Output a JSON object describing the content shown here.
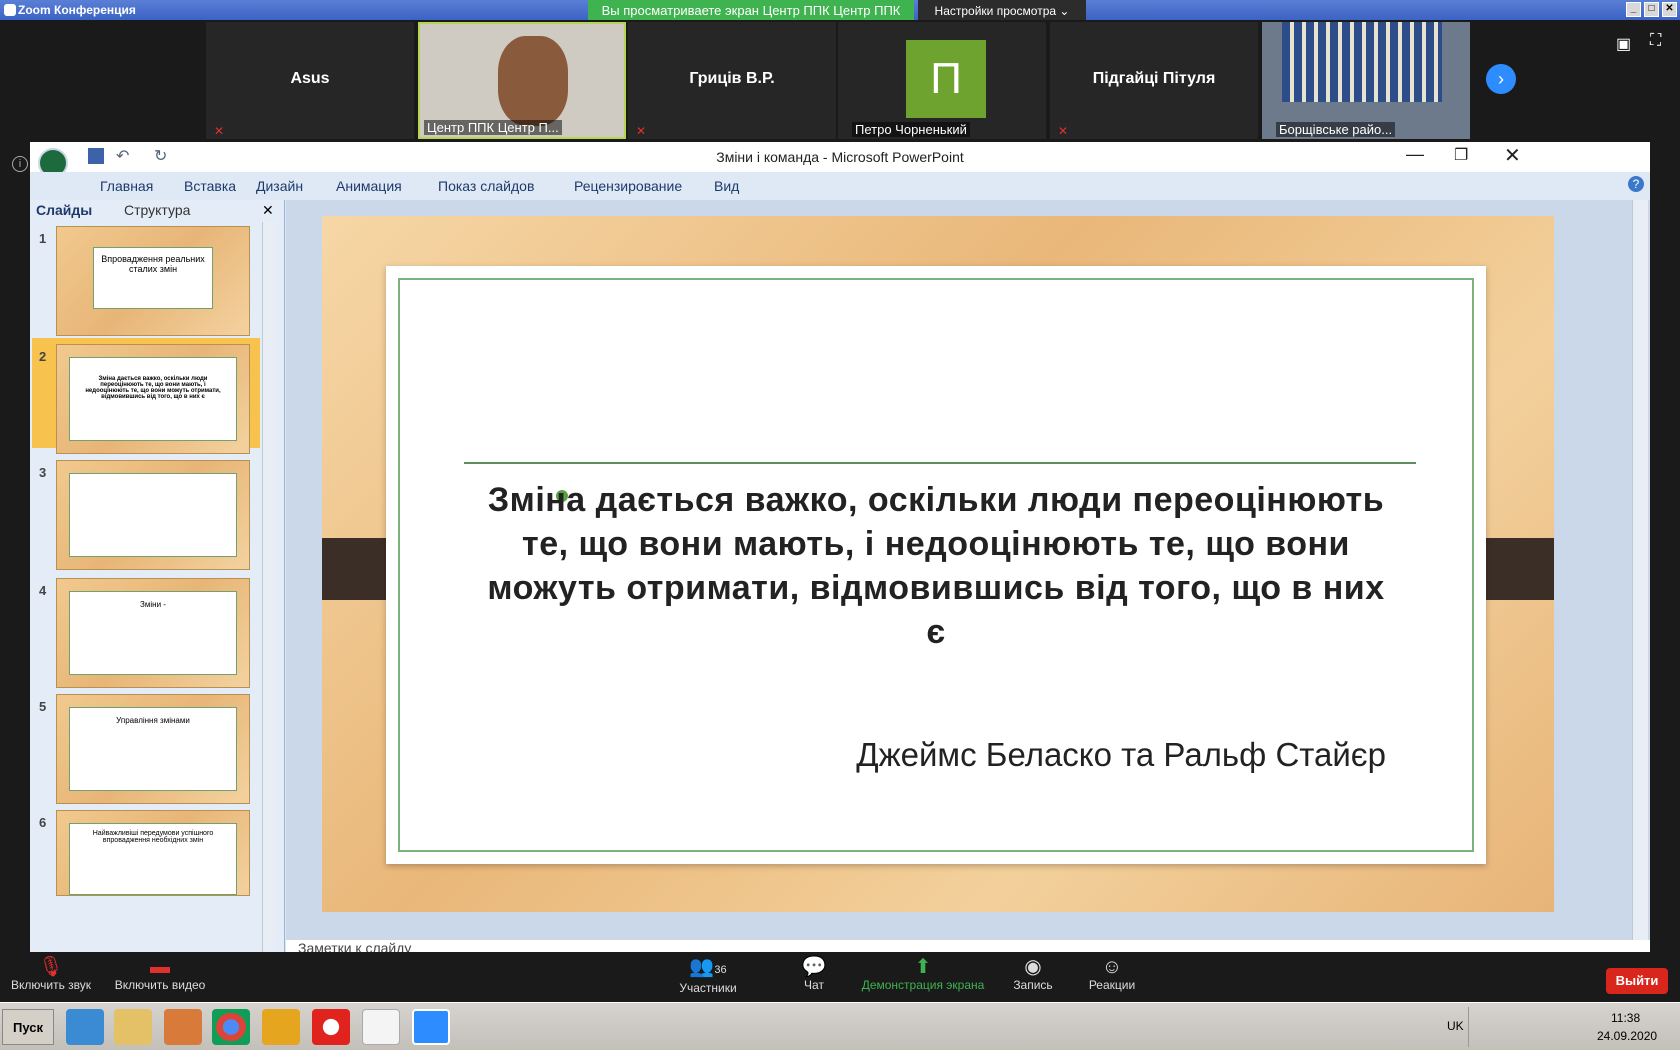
{
  "window": {
    "title": "Zoom Конференция"
  },
  "share_banner": "Вы просматриваете экран Центр ППК Центр ППК",
  "view_options": "Настройки просмотра ⌄",
  "participants": [
    {
      "name": "Asus",
      "caption": ""
    },
    {
      "name": "",
      "caption": "Центр ППК Центр П..."
    },
    {
      "name": "Гриців В.Р.",
      "caption": ""
    },
    {
      "name": "П",
      "caption": "Петро Чорненький"
    },
    {
      "name": "Підгайці Пітуля",
      "caption": ""
    },
    {
      "name": "",
      "caption": "Борщівське райо..."
    }
  ],
  "ppt": {
    "title": "Зміни і команда - Microsoft PowerPoint",
    "ribbon_tabs": [
      "Главная",
      "Вставка",
      "Дизайн",
      "Анимация",
      "Показ слайдов",
      "Рецензирование",
      "Вид"
    ],
    "pane_tabs": [
      "Слайды",
      "Структура"
    ],
    "thumbnails": [
      {
        "num": "1",
        "text": "Впровадження реальних сталих змін"
      },
      {
        "num": "2",
        "text": "Зміна дається важко, оскільки люди переоцінюють те, що вони мають, і недооцінюють те, що вони можуть отримати, відмовившись від того, що в них є"
      },
      {
        "num": "3",
        "text": ""
      },
      {
        "num": "4",
        "text": "Зміни -"
      },
      {
        "num": "5",
        "text": "Управління змінами"
      },
      {
        "num": "6",
        "text": "Найважливіші передумови успішного впровадження необхідних змін"
      }
    ],
    "slide": {
      "quote": "Зміна дається важко, оскільки люди переоцінюють те, що вони мають, і недооцінюють те, що вони можуть отримати, відмовившись від того, що в них є",
      "author": "Джеймс Беласко та Ральф Стайєр"
    },
    "notes_placeholder": "Заметки к слайду"
  },
  "toolbar": {
    "mute": "Включить звук",
    "video": "Включить видео",
    "participants": "Участники",
    "participants_count": "36",
    "chat": "Чат",
    "share": "Демонстрация экрана",
    "record": "Запись",
    "reactions": "Реакции",
    "leave": "Выйти"
  },
  "taskbar": {
    "start": "Пуск",
    "lang": "UK",
    "time": "11:38",
    "date": "24.09.2020"
  },
  "colors": {
    "share_green": "#3fb34f",
    "leave_red": "#d9261c",
    "slide_wood": "#e9b779"
  }
}
